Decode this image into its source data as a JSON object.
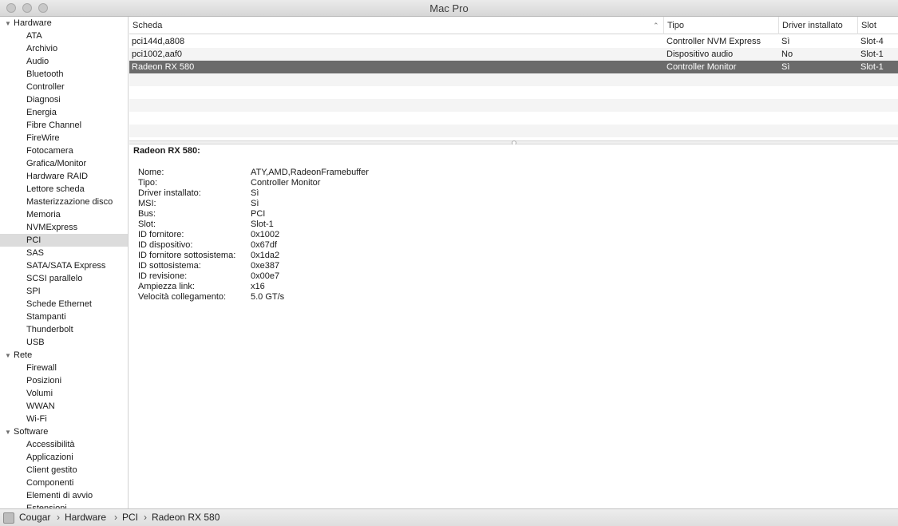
{
  "window": {
    "title": "Mac Pro"
  },
  "sidebar": {
    "categories": [
      {
        "label": "Hardware",
        "items": [
          "ATA",
          "Archivio",
          "Audio",
          "Bluetooth",
          "Controller",
          "Diagnosi",
          "Energia",
          "Fibre Channel",
          "FireWire",
          "Fotocamera",
          "Grafica/Monitor",
          "Hardware RAID",
          "Lettore scheda",
          "Masterizzazione disco",
          "Memoria",
          "NVMExpress",
          "PCI",
          "SAS",
          "SATA/SATA Express",
          "SCSI parallelo",
          "SPI",
          "Schede Ethernet",
          "Stampanti",
          "Thunderbolt",
          "USB"
        ]
      },
      {
        "label": "Rete",
        "items": [
          "Firewall",
          "Posizioni",
          "Volumi",
          "WWAN",
          "Wi-Fi"
        ]
      },
      {
        "label": "Software",
        "items": [
          "Accessibilità",
          "Applicazioni",
          "Client gestito",
          "Componenti",
          "Elementi di avvio",
          "Estensioni"
        ]
      }
    ],
    "selected": "PCI"
  },
  "table": {
    "columns": [
      "Scheda",
      "Tipo",
      "Driver installato",
      "Slot"
    ],
    "rows": [
      [
        "pci144d,a808",
        "Controller NVM Express",
        "Sì",
        "Slot-4"
      ],
      [
        "pci1002,aaf0",
        "Dispositivo audio",
        "No",
        "Slot-1"
      ],
      [
        "Radeon RX 580",
        "Controller Monitor",
        "Sì",
        "Slot-1"
      ]
    ],
    "selected_row": 2
  },
  "detail": {
    "title": "Radeon RX 580:",
    "properties": [
      [
        "Nome:",
        "ATY,AMD,RadeonFramebuffer"
      ],
      [
        "Tipo:",
        "Controller Monitor"
      ],
      [
        "Driver installato:",
        "Sì"
      ],
      [
        "MSI:",
        "Sì"
      ],
      [
        "Bus:",
        "PCI"
      ],
      [
        "Slot:",
        "Slot-1"
      ],
      [
        "ID fornitore:",
        "0x1002"
      ],
      [
        "ID dispositivo:",
        "0x67df"
      ],
      [
        "ID fornitore sottosistema:",
        "0x1da2"
      ],
      [
        "ID sottosistema:",
        "0xe387"
      ],
      [
        "ID revisione:",
        "0x00e7"
      ],
      [
        "Ampiezza link:",
        "x16"
      ],
      [
        "Velocità collegamento:",
        "5.0 GT/s"
      ]
    ]
  },
  "breadcrumb": [
    "Cougar",
    "Hardware",
    "PCI",
    "Radeon RX 580"
  ]
}
